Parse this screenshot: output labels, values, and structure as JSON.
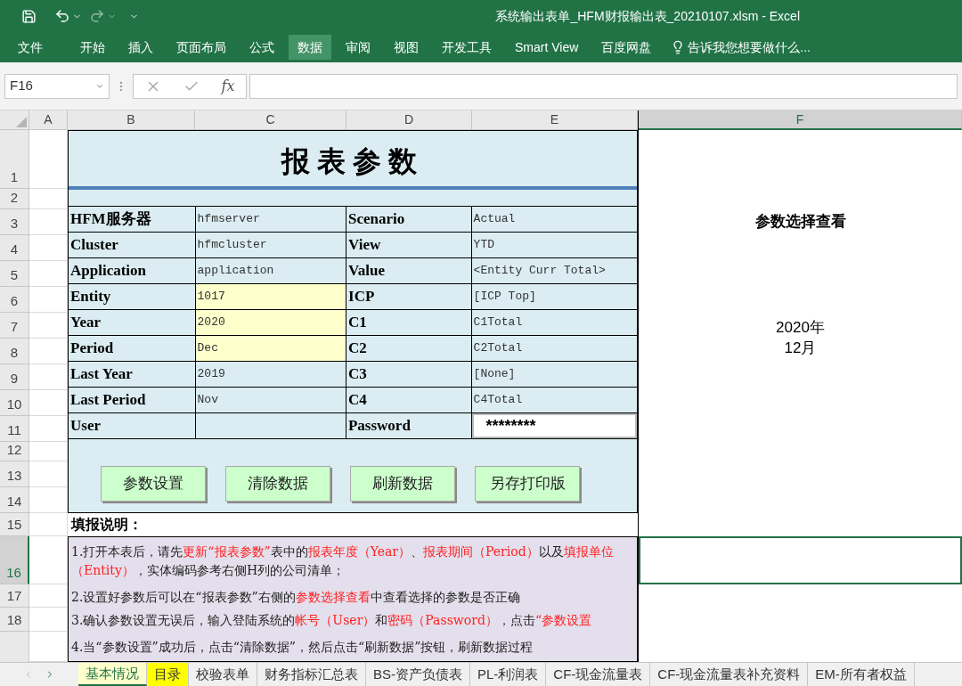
{
  "window": {
    "title": "系统输出表单_HFM财报输出表_20210107.xlsm - Excel"
  },
  "ribbon_tabs": [
    {
      "label": "文件",
      "selected": false
    },
    {
      "label": "开始",
      "selected": false
    },
    {
      "label": "插入",
      "selected": false
    },
    {
      "label": "页面布局",
      "selected": false
    },
    {
      "label": "公式",
      "selected": false
    },
    {
      "label": "数据",
      "selected": true
    },
    {
      "label": "审阅",
      "selected": false
    },
    {
      "label": "视图",
      "selected": false
    },
    {
      "label": "开发工具",
      "selected": false
    },
    {
      "label": "Smart View",
      "selected": false
    },
    {
      "label": "百度网盘",
      "selected": false
    }
  ],
  "tell_me": {
    "placeholder": "告诉我您想要做什么..."
  },
  "formula_bar": {
    "name_box": "F16",
    "function_label": "fx"
  },
  "columns": [
    {
      "label": "A",
      "selected": false
    },
    {
      "label": "B",
      "selected": false
    },
    {
      "label": "C",
      "selected": false
    },
    {
      "label": "D",
      "selected": false
    },
    {
      "label": "E",
      "selected": false
    },
    {
      "label": "F",
      "selected": true
    }
  ],
  "rows": [
    {
      "label": "1",
      "selected": false
    },
    {
      "label": "2",
      "selected": false
    },
    {
      "label": "3",
      "selected": false
    },
    {
      "label": "4",
      "selected": false
    },
    {
      "label": "5",
      "selected": false
    },
    {
      "label": "6",
      "selected": false
    },
    {
      "label": "7",
      "selected": false
    },
    {
      "label": "8",
      "selected": false
    },
    {
      "label": "9",
      "selected": false
    },
    {
      "label": "10",
      "selected": false
    },
    {
      "label": "11",
      "selected": false
    },
    {
      "label": "12",
      "selected": false
    },
    {
      "label": "13",
      "selected": false
    },
    {
      "label": "14",
      "selected": false
    },
    {
      "label": "15",
      "selected": false
    },
    {
      "label": "16",
      "selected": true
    },
    {
      "label": "17",
      "selected": false
    },
    {
      "label": "18",
      "selected": false
    }
  ],
  "sheet": {
    "title": "报表参数",
    "parameter_rows": [
      {
        "left": {
          "label": "HFM服务器",
          "value": "hfmserver",
          "highlighted": false
        },
        "right": {
          "label": "Scenario",
          "value": "Actual",
          "kind": "text"
        }
      },
      {
        "left": {
          "label": "Cluster",
          "value": "hfmcluster",
          "highlighted": false
        },
        "right": {
          "label": "View",
          "value": "YTD",
          "kind": "text"
        }
      },
      {
        "left": {
          "label": "Application",
          "value": "application",
          "highlighted": false
        },
        "right": {
          "label": "Value",
          "value": "<Entity Curr Total>",
          "kind": "text"
        }
      },
      {
        "left": {
          "label": "Entity",
          "value": "1017",
          "highlighted": true
        },
        "right": {
          "label": "ICP",
          "value": "[ICP Top]",
          "kind": "text"
        }
      },
      {
        "left": {
          "label": "Year",
          "value": "2020",
          "highlighted": true
        },
        "right": {
          "label": "C1",
          "value": "C1Total",
          "kind": "text"
        }
      },
      {
        "left": {
          "label": "Period",
          "value": "Dec",
          "highlighted": true
        },
        "right": {
          "label": "C2",
          "value": "C2Total",
          "kind": "text"
        }
      },
      {
        "left": {
          "label": "Last Year",
          "value": "2019",
          "highlighted": false
        },
        "right": {
          "label": "C3",
          "value": "[None]",
          "kind": "text"
        }
      },
      {
        "left": {
          "label": "Last Period",
          "value": "Nov",
          "highlighted": false
        },
        "right": {
          "label": "C4",
          "value": "C4Total",
          "kind": "text"
        }
      },
      {
        "left": {
          "label": "User",
          "highlighted": false
        },
        "right": {
          "label": "Password",
          "value": "********",
          "kind": "password"
        }
      }
    ],
    "buttons": [
      "参数设置",
      "清除数据",
      "刷新数据",
      "另存打印版"
    ],
    "notes_title": "填报说明：",
    "notes": [
      {
        "segments": [
          {
            "text": "1.打开本表后，请先",
            "kind": "plain"
          },
          {
            "text": "更新“报表参数”",
            "kind": "highlight"
          },
          {
            "text": "表中的",
            "kind": "plain"
          },
          {
            "text": "报表年度（Year）",
            "kind": "highlight"
          },
          {
            "text": "、",
            "kind": "plain"
          },
          {
            "text": "报表期间（Period）",
            "kind": "highlight"
          },
          {
            "text": "以及",
            "kind": "plain"
          },
          {
            "text": "填报单位（Entity）",
            "kind": "highlight"
          },
          {
            "text": "，实体编码参考右侧H列的公司清单；",
            "kind": "plain"
          }
        ]
      },
      {
        "segments": [
          {
            "text": "2.设置好参数后可以在“报表参数”右侧的",
            "kind": "plain"
          },
          {
            "text": "参数选择查看",
            "kind": "highlight"
          },
          {
            "text": "中查看选择的参数是否正确",
            "kind": "plain"
          }
        ]
      },
      {
        "segments": [
          {
            "text": "3.确认参数设置无误后，输入登陆系统的",
            "kind": "plain"
          },
          {
            "text": "帐号（User）",
            "kind": "highlight"
          },
          {
            "text": "和",
            "kind": "plain"
          },
          {
            "text": "密码（Password）",
            "kind": "highlight"
          },
          {
            "text": "，点击",
            "kind": "plain"
          },
          {
            "text": "“参数设置",
            "kind": "highlight"
          }
        ]
      },
      {
        "segments": [
          {
            "text": "4.当“参数设置”成功后，点击“清除数据”，然后点击“刷新数据”按钮，刷新数据过程",
            "kind": "plain"
          }
        ]
      }
    ]
  },
  "side_panel": {
    "heading": "参数选择查看",
    "year": "2020年",
    "month": "12月"
  },
  "sheet_tabs": [
    {
      "label": "基本情况",
      "selected": true,
      "color": "#ffffcc"
    },
    {
      "label": "目录",
      "selected": false,
      "color": "#ffff00"
    },
    {
      "label": "校验表单",
      "selected": false
    },
    {
      "label": "财务指标汇总表",
      "selected": false
    },
    {
      "label": "BS-资产负债表",
      "selected": false
    },
    {
      "label": "PL-利润表",
      "selected": false
    },
    {
      "label": "CF-现金流量表",
      "selected": false
    },
    {
      "label": "CF-现金流量表补充资料",
      "selected": false
    },
    {
      "label": "EM-所有者权益",
      "selected": false
    }
  ]
}
